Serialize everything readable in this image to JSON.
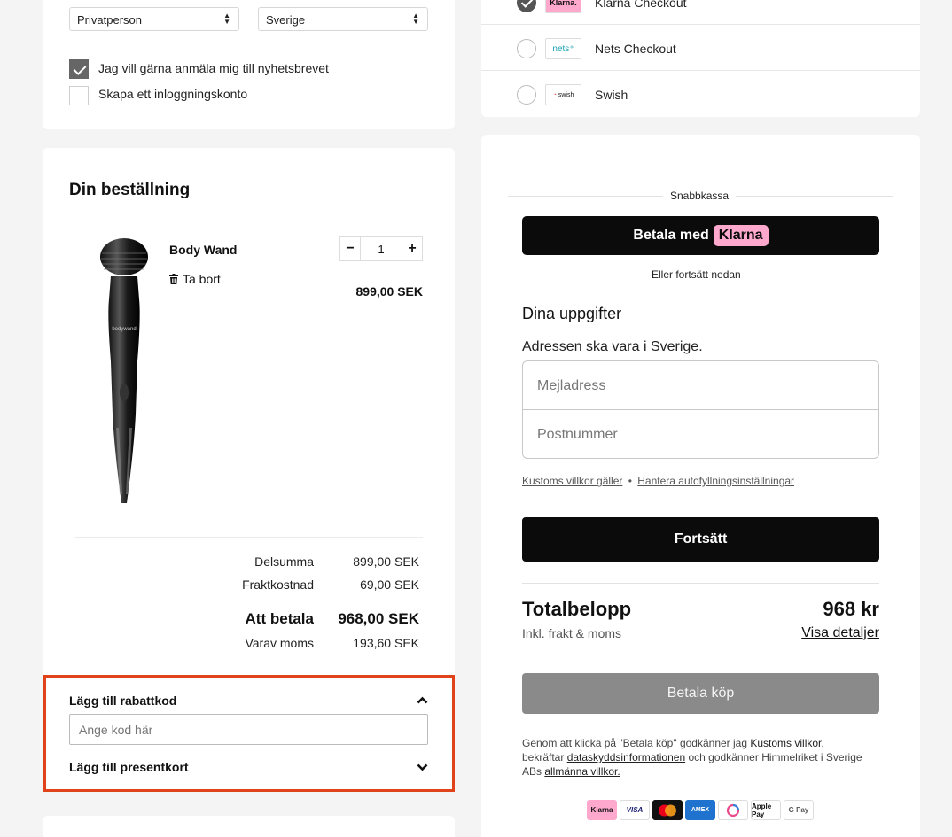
{
  "customer": {
    "type_select": "Privatperson",
    "country_select": "Sverige",
    "newsletter_label": "Jag vill gärna anmäla mig till nyhetsbrevet",
    "newsletter_checked": true,
    "account_label": "Skapa ett inloggningskonto",
    "account_checked": false
  },
  "order": {
    "heading": "Din beställning",
    "product_name": "Body Wand",
    "remove_label": "Ta bort",
    "quantity": "1",
    "price": "899,00 SEK",
    "image_brand": "bodywand",
    "summary": [
      {
        "label": "Delsumma",
        "value": "899,00 SEK"
      },
      {
        "label": "Fraktkostnad",
        "value": "69,00 SEK"
      },
      {
        "label": "Att betala",
        "value": "968,00 SEK"
      },
      {
        "label": "Varav moms",
        "value": "193,60 SEK"
      }
    ]
  },
  "discount": {
    "title": "Lägg till rabattkod",
    "placeholder": "Ange kod här",
    "gift_title": "Lägg till presentkort"
  },
  "payment_methods": [
    {
      "name": "Klarna Checkout",
      "logo": "Klarna.",
      "selected": true
    },
    {
      "name": "Nets Checkout",
      "logo": "nets",
      "selected": false
    },
    {
      "name": "Swish",
      "logo": "swish",
      "selected": false
    }
  ],
  "klarna": {
    "express_label": "Snabbkassa",
    "pay_with": "Betala med",
    "brand": "Klarna",
    "or_continue": "Eller fortsätt nedan",
    "details_heading": "Dina uppgifter",
    "address_note": "Adressen ska vara i Sverige.",
    "email_placeholder": "Mejladress",
    "postal_placeholder": "Postnummer",
    "terms_link": "Kustoms villkor gäller",
    "separator": "•",
    "autofill_link": "Hantera autofyllningsinställningar",
    "continue_button": "Fortsätt",
    "total_label": "Totalbelopp",
    "total_value": "968 kr",
    "incl_label": "Inkl. frakt & moms",
    "details_link": "Visa detaljer",
    "pay_button": "Betala köp",
    "legal_1": "Genom att klicka på \"Betala köp\" godkänner jag ",
    "legal_link1": "Kustoms villkor",
    "legal_2": ", bekräftar ",
    "legal_link2": "dataskyddsinformationen",
    "legal_3": " och godkänner Himmelriket i Sverige ABs ",
    "legal_link3": "allmänna villkor.",
    "payment_icons": [
      "Klarna",
      "VISA",
      "mastercard",
      "AMEX",
      "spinner",
      "Apple Pay",
      "G Pay"
    ]
  },
  "colors": {
    "highlight_border": "#e0421a",
    "klarna_pink": "#ffa8cd",
    "cta_black": "#0b0b0b",
    "cta_disabled": "#8a8a8a"
  }
}
